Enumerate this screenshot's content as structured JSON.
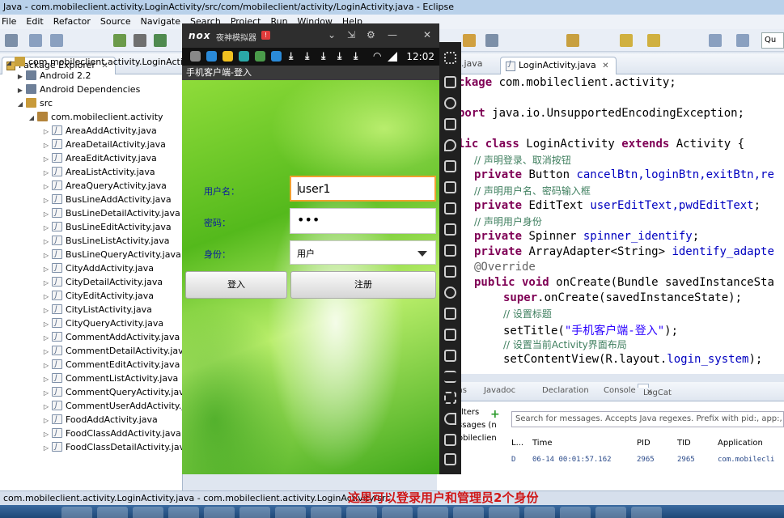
{
  "window": {
    "title": "Java - com.mobileclient.activity.LoginActivity/src/com/mobileclient/activity/LoginActivity.java - Eclipse"
  },
  "menu": [
    "File",
    "Edit",
    "Refactor",
    "Source",
    "Navigate",
    "Search",
    "Project",
    "Run",
    "Window",
    "Help"
  ],
  "toolbar": {
    "quick_access": "Qu"
  },
  "package_explorer": {
    "tab_label": "Package Explorer",
    "close_label": "✕",
    "project": "com.mobileclient.activity.LoginActivity",
    "items": [
      {
        "label": "Android 2.2",
        "type": "lib"
      },
      {
        "label": "Android Dependencies",
        "type": "lib"
      },
      {
        "label": "src",
        "type": "src"
      },
      {
        "label": "com.mobileclient.activity",
        "type": "pkg"
      }
    ],
    "files": [
      "AreaAddActivity.java",
      "AreaDetailActivity.java",
      "AreaEditActivity.java",
      "AreaListActivity.java",
      "AreaQueryActivity.java",
      "BusLineAddActivity.java",
      "BusLineDetailActivity.java",
      "BusLineEditActivity.java",
      "BusLineListActivity.java",
      "BusLineQueryActivity.java",
      "CityAddActivity.java",
      "CityDetailActivity.java",
      "CityEditActivity.java",
      "CityListActivity.java",
      "CityQueryActivity.java",
      "CommentAddActivity.java",
      "CommentDetailActivity.java",
      "CommentEditActivity.java",
      "CommentListActivity.java",
      "CommentQueryActivity.java",
      "CommentUserAddActivity.java",
      "FoodAddActivity.java",
      "FoodClassAddActivity.java",
      "FoodClassDetailActivity.java"
    ]
  },
  "editor": {
    "tab_inactive": ".java",
    "tab_active": "LoginActivity.java",
    "tab_close": "✕",
    "lines": [
      {
        "kw": "ckage",
        "rest": " com.mobileclient.activity;"
      },
      {
        "kw": "port",
        "rest": " java.io.UnsupportedEncodingException;"
      },
      {
        "kw": "lic class",
        "rest": " LoginActivity ",
        "kw2": "extends",
        "rest2": " Activity {"
      },
      {
        "comment": "// 声明登录、取消按钮"
      },
      {
        "kw": "private",
        "rest": " Button ",
        "fld": "cancelBtn,loginBtn,exitBtn,re"
      },
      {
        "comment": "// 声明用户名、密码输入框"
      },
      {
        "kw": "private",
        "rest": " EditText ",
        "fld": "userEditText,pwdEditText",
        "tail": ";"
      },
      {
        "comment": "// 声明用户身份"
      },
      {
        "kw": "private",
        "rest": " Spinner ",
        "fld": "spinner_identify",
        "tail": ";"
      },
      {
        "kw": "private",
        "rest": " ArrayAdapter<String> ",
        "fld": "identify_adapte"
      },
      {
        "annotation": "@Override"
      },
      {
        "kw": "public void",
        "rest": " onCreate(Bundle savedInstanceSta"
      },
      {
        "kw": "super",
        "rest": ".onCreate(savedInstanceState);"
      },
      {
        "comment": "// 设置标题"
      },
      {
        "rest": "setTitle(",
        "str": "\"手机客户端-登入\"",
        "tail": ");"
      },
      {
        "comment": "// 设置当前Activity界面布局"
      },
      {
        "rest": "setContentView(R.layout.",
        "fld": "login_system",
        "tail": ");"
      }
    ]
  },
  "bottom_views": {
    "tabs": [
      "ms",
      "Javadoc",
      "Declaration",
      "Console",
      "LogCat"
    ],
    "logcat_close": "✕",
    "search_placeholder": "Search for messages. Accepts Java regexes. Prefix with pid:, app:, tag:",
    "filters_label": "lters",
    "filters_items": [
      "ssages (n",
      "obileclien"
    ],
    "columns": [
      "L...",
      "Time",
      "PID",
      "TID",
      "Application"
    ],
    "row": {
      "level": "D",
      "time": "06-14 00:01:57.162",
      "pid": "2965",
      "tid": "2965",
      "app": "com.mobilecli"
    }
  },
  "status_bar": {
    "path": "com.mobileclient.activity.LoginActivity.java - com.mobileclient.activity.LoginActivity/src",
    "caption": "这里可以登录用户和管理员2个身份"
  },
  "emulator": {
    "logo": "nox",
    "name": "夜神模拟器",
    "badge": "!",
    "controls": [
      "⌄",
      "⇲",
      "⚙",
      "—",
      "✕"
    ],
    "clock": "12:02",
    "app_title": "手机客户端-登入",
    "form": {
      "username_label": "用户名：",
      "username_value": "user1",
      "password_label": "密码：",
      "password_value": "•••",
      "identity_label": "身份：",
      "identity_value": "用户",
      "login_button": "登入",
      "register_button": "注册"
    }
  },
  "colors": {
    "keyword": "#7f0055",
    "comment": "#3f7f5f",
    "field": "#0000c0",
    "caption_red": "#d01818",
    "form_label": "#0a1aa0"
  }
}
